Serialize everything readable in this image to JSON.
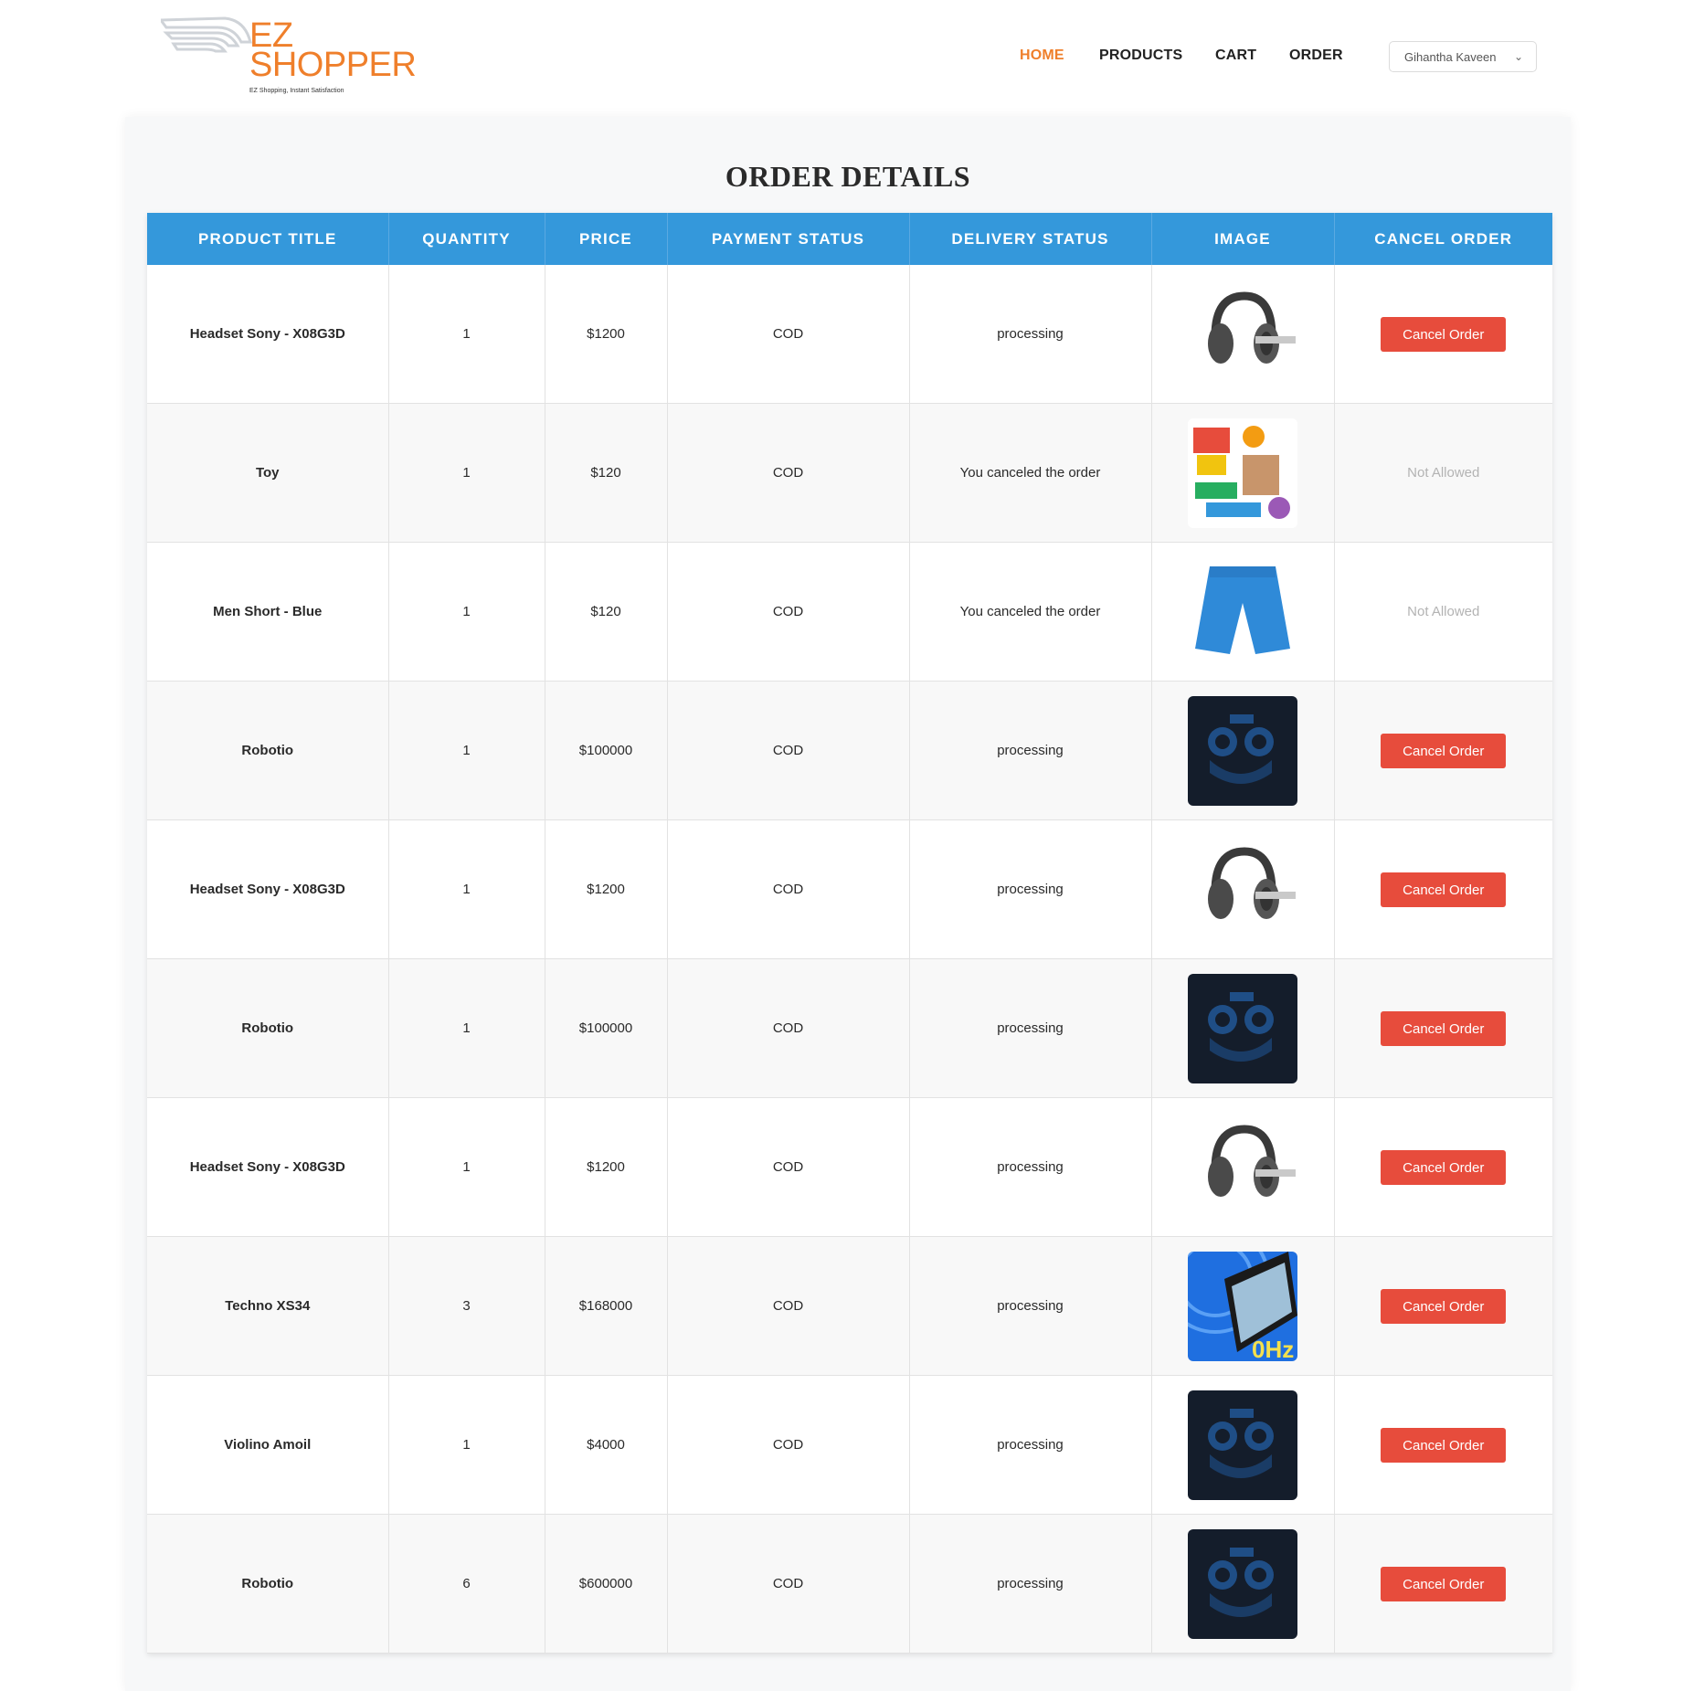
{
  "brand": {
    "line1": "EZ",
    "line2": "SHOPPER",
    "tagline": "EZ Shopping, Instant Satisfaction"
  },
  "nav": {
    "items": [
      {
        "label": "HOME",
        "active": true
      },
      {
        "label": "PRODUCTS",
        "active": false
      },
      {
        "label": "CART",
        "active": false
      },
      {
        "label": "ORDER",
        "active": false
      }
    ]
  },
  "user": {
    "name": "Gihantha Kaveen"
  },
  "page": {
    "title": "ORDER DETAILS"
  },
  "table": {
    "headers": [
      "PRODUCT TITLE",
      "QUANTITY",
      "PRICE",
      "PAYMENT STATUS",
      "DELIVERY STATUS",
      "IMAGE",
      "CANCEL ORDER"
    ],
    "rows": [
      {
        "title": "Headset Sony - X08G3D",
        "quantity": "1",
        "price": "$1200",
        "payment": "COD",
        "delivery": "processing",
        "image": "headset",
        "action": "Cancel Order",
        "can_cancel": true
      },
      {
        "title": "Toy",
        "quantity": "1",
        "price": "$120",
        "payment": "COD",
        "delivery": "You canceled the order",
        "image": "toy",
        "action": "Not Allowed",
        "can_cancel": false
      },
      {
        "title": "Men Short - Blue",
        "quantity": "1",
        "price": "$120",
        "payment": "COD",
        "delivery": "You canceled the order",
        "image": "shorts",
        "action": "Not Allowed",
        "can_cancel": false
      },
      {
        "title": "Robotio",
        "quantity": "1",
        "price": "$100000",
        "payment": "COD",
        "delivery": "processing",
        "image": "robot",
        "action": "Cancel Order",
        "can_cancel": true
      },
      {
        "title": "Headset Sony - X08G3D",
        "quantity": "1",
        "price": "$1200",
        "payment": "COD",
        "delivery": "processing",
        "image": "headset",
        "action": "Cancel Order",
        "can_cancel": true
      },
      {
        "title": "Robotio",
        "quantity": "1",
        "price": "$100000",
        "payment": "COD",
        "delivery": "processing",
        "image": "robot",
        "action": "Cancel Order",
        "can_cancel": true
      },
      {
        "title": "Headset Sony - X08G3D",
        "quantity": "1",
        "price": "$1200",
        "payment": "COD",
        "delivery": "processing",
        "image": "headset",
        "action": "Cancel Order",
        "can_cancel": true
      },
      {
        "title": "Techno XS34",
        "quantity": "3",
        "price": "$168000",
        "payment": "COD",
        "delivery": "processing",
        "image": "phone",
        "action": "Cancel Order",
        "can_cancel": true
      },
      {
        "title": "Violino Amoil",
        "quantity": "1",
        "price": "$4000",
        "payment": "COD",
        "delivery": "processing",
        "image": "robot",
        "action": "Cancel Order",
        "can_cancel": true
      },
      {
        "title": "Robotio",
        "quantity": "6",
        "price": "$600000",
        "payment": "COD",
        "delivery": "processing",
        "image": "robot",
        "action": "Cancel Order",
        "can_cancel": true
      }
    ]
  },
  "colors": {
    "accent": "#ef7f2b",
    "header": "#3498db",
    "cancel": "#e74c3c"
  }
}
